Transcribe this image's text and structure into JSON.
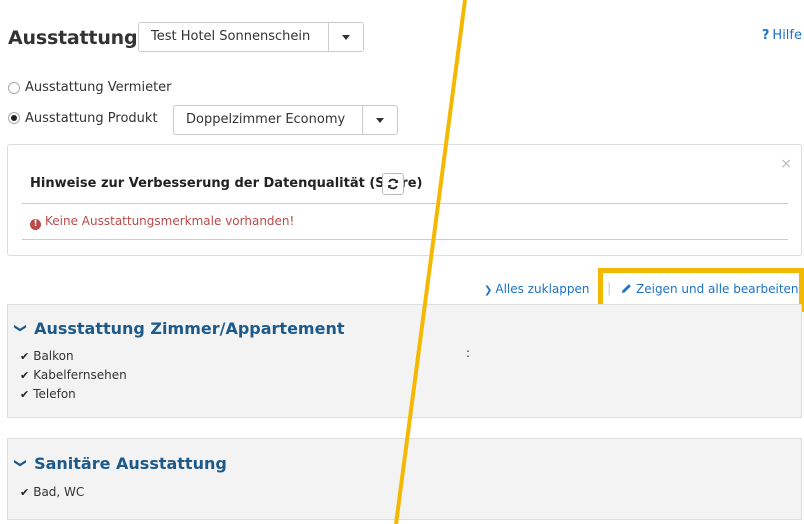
{
  "page": {
    "title": "Ausstattung",
    "help_label": "Hilfe",
    "help_icon": "?"
  },
  "hotel_select": {
    "value": "Test Hotel Sonnenschein"
  },
  "radios": [
    {
      "label": "Ausstattung Vermieter",
      "checked": false
    },
    {
      "label": "Ausstattung Produkt",
      "checked": true
    }
  ],
  "room_select": {
    "value": "Doppelzimmer Economy"
  },
  "quality_panel": {
    "title": "Hinweise zur Verbesserung der Datenqualität (Score)",
    "warning": "Keine Ausstattungsmerkmale vorhanden!",
    "close": "×"
  },
  "actions": {
    "collapse_all": "Alles zuklappen",
    "separator": "|",
    "edit_all": "Zeigen und alle bearbeiten"
  },
  "sections": [
    {
      "title": "Ausstattung Zimmer/Appartement",
      "items": [
        "Balkon",
        "Kabelfernsehen",
        "Telefon"
      ]
    },
    {
      "title": "Sanitäre Ausstattung",
      "items": [
        "Bad, WC"
      ]
    }
  ],
  "stray_text": ":",
  "colors": {
    "link": "#1a73c8",
    "section_title": "#1d5a8a",
    "warning": "#b94a48",
    "highlight": "#f5b800"
  }
}
